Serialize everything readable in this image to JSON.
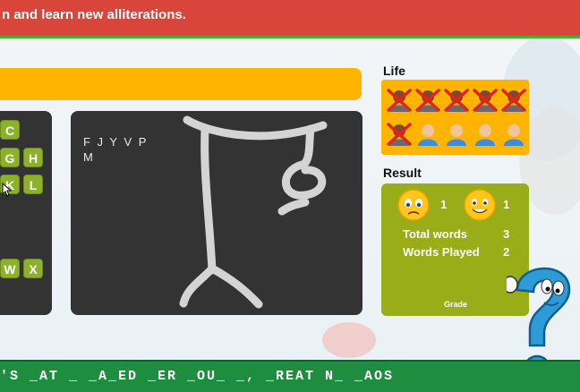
{
  "banner": {
    "text": "n and learn new alliterations."
  },
  "keyboard": {
    "keys": [
      "C",
      "G",
      "H",
      "K",
      "L",
      "W",
      "X"
    ]
  },
  "hangman": {
    "guessed_letters": "F J Y V P M"
  },
  "life": {
    "title": "Life",
    "lives_total": 10,
    "lives_lost": 6
  },
  "result": {
    "title": "Result",
    "sad_count": "1",
    "happy_count": "1",
    "total_words_label": "Total words",
    "total_words_value": "3",
    "words_played_label": "Words Played",
    "words_played_value": "2",
    "grade_label": "Grade"
  },
  "puzzle": {
    "phrase": "'S _AT _ _A_ED _ER _OU_ _, _REAT N_ _AOS"
  },
  "colors": {
    "banner": "#d9453b",
    "accent_yellow": "#ffb400",
    "key_green": "#8cb12b",
    "result_green": "#98ad18",
    "bottom_green": "#1e8d3f",
    "panel_dark": "#333333"
  }
}
